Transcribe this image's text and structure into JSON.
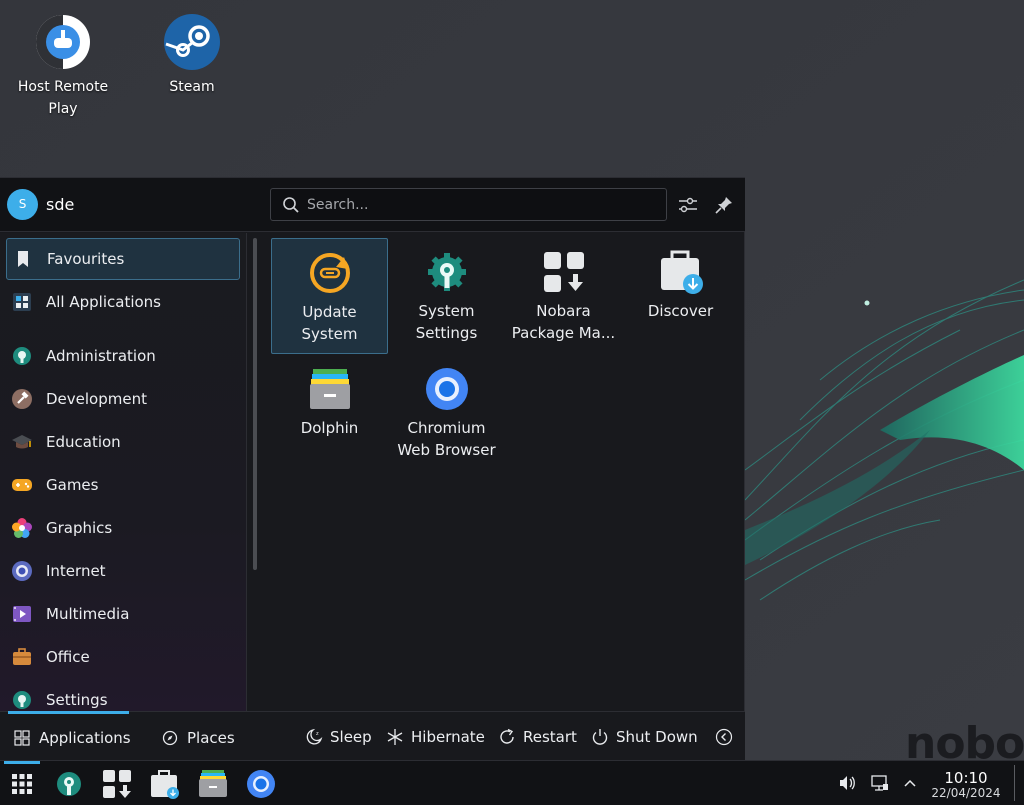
{
  "desktop": {
    "icons": [
      {
        "label": "Host Remote Play",
        "icon": "remote-play-icon"
      },
      {
        "label": "Steam",
        "icon": "steam-icon"
      }
    ],
    "watermark": "nobo"
  },
  "launcher": {
    "user": {
      "avatar_initial": "S",
      "name": "sde"
    },
    "search": {
      "placeholder": "Search...",
      "value": ""
    },
    "header_buttons": [
      {
        "name": "configure",
        "icon": "sliders-icon"
      },
      {
        "name": "pin",
        "icon": "pin-icon"
      }
    ],
    "categories": [
      {
        "label": "Favourites",
        "icon": "bookmark-icon",
        "active": true
      },
      {
        "label": "All Applications",
        "icon": "grid-icon"
      },
      {
        "label": "Administration",
        "icon": "gear-wrench-icon"
      },
      {
        "label": "Development",
        "icon": "hammer-icon"
      },
      {
        "label": "Education",
        "icon": "graduation-cap-icon"
      },
      {
        "label": "Games",
        "icon": "gamepad-icon"
      },
      {
        "label": "Graphics",
        "icon": "flower-icon"
      },
      {
        "label": "Internet",
        "icon": "globe-icon"
      },
      {
        "label": "Multimedia",
        "icon": "film-icon"
      },
      {
        "label": "Office",
        "icon": "briefcase-icon"
      },
      {
        "label": "Settings",
        "icon": "gear-wrench-icon"
      }
    ],
    "apps": [
      {
        "line1": "Update",
        "line2": "System",
        "icon": "update-icon",
        "selected": true
      },
      {
        "line1": "System",
        "line2": "Settings",
        "icon": "settings-icon"
      },
      {
        "line1": "Nobara",
        "line2": "Package Ma...",
        "icon": "package-manager-icon"
      },
      {
        "line1": "Discover",
        "line2": "",
        "icon": "discover-icon"
      },
      {
        "line1": "Dolphin",
        "line2": "",
        "icon": "dolphin-icon"
      },
      {
        "line1": "Chromium",
        "line2": "Web Browser",
        "icon": "chromium-icon"
      }
    ],
    "footer": {
      "tabs": [
        {
          "label": "Applications",
          "icon": "apps-grid-icon",
          "active": true
        },
        {
          "label": "Places",
          "icon": "compass-icon"
        }
      ],
      "power": [
        {
          "label": "Sleep",
          "icon": "sleep-icon"
        },
        {
          "label": "Hibernate",
          "icon": "snowflake-icon"
        },
        {
          "label": "Restart",
          "icon": "restart-icon"
        },
        {
          "label": "Shut Down",
          "icon": "power-icon"
        }
      ]
    }
  },
  "taskbar": {
    "items": [
      "launcher-icon",
      "system-settings-icon",
      "package-manager-icon",
      "discover-icon",
      "dolphin-icon",
      "chromium-icon"
    ],
    "clock": {
      "time": "10:10",
      "date": "22/04/2024"
    }
  },
  "colors": {
    "accent": "#3daee9",
    "selection_bg": "#1f3240",
    "panel_bg": "#18191d",
    "taskbar_bg": "#111215"
  }
}
